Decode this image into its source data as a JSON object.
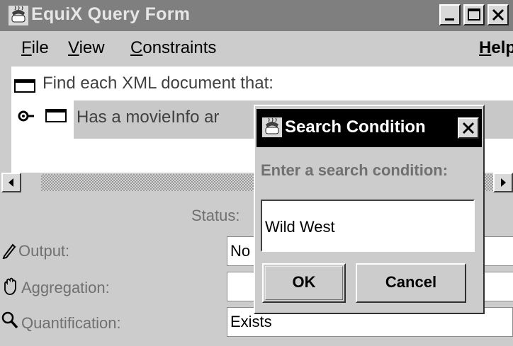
{
  "window": {
    "title": "EquiX Query Form",
    "buttons": {
      "minimize": "minimize-icon",
      "maximize": "maximize-icon",
      "close": "close-icon"
    }
  },
  "menu": {
    "file": {
      "u": "F",
      "rest": "ile"
    },
    "view": {
      "u": "V",
      "rest": "iew"
    },
    "constraints": {
      "u": "C",
      "rest": "onstraints"
    },
    "help": {
      "pre": "",
      "u": "H",
      "rest": "elp"
    }
  },
  "tree": {
    "root_label": "Find each XML document that:",
    "node_label": "Has a movieInfo ar",
    "icons": {
      "root": "folder-icon",
      "node": "folder-icon",
      "handle": "expand-handle-icon"
    }
  },
  "status": {
    "label": "Status:"
  },
  "fields": [
    {
      "label": "Output:",
      "value": "No",
      "icon": "pencil-icon"
    },
    {
      "label": "Aggregation:",
      "value": "",
      "icon": "hand-icon"
    },
    {
      "label": "Quantification:",
      "value": "Exists",
      "icon": "magnifier-icon"
    }
  ],
  "dialog": {
    "title": "Search Condition",
    "prompt": "Enter a search condition:",
    "input_value": "Wild West",
    "ok_label": "OK",
    "cancel_label": "Cancel"
  },
  "colors": {
    "title_active": "#000000",
    "title_inactive": "#7f7f7f",
    "face": "#cccccc"
  }
}
